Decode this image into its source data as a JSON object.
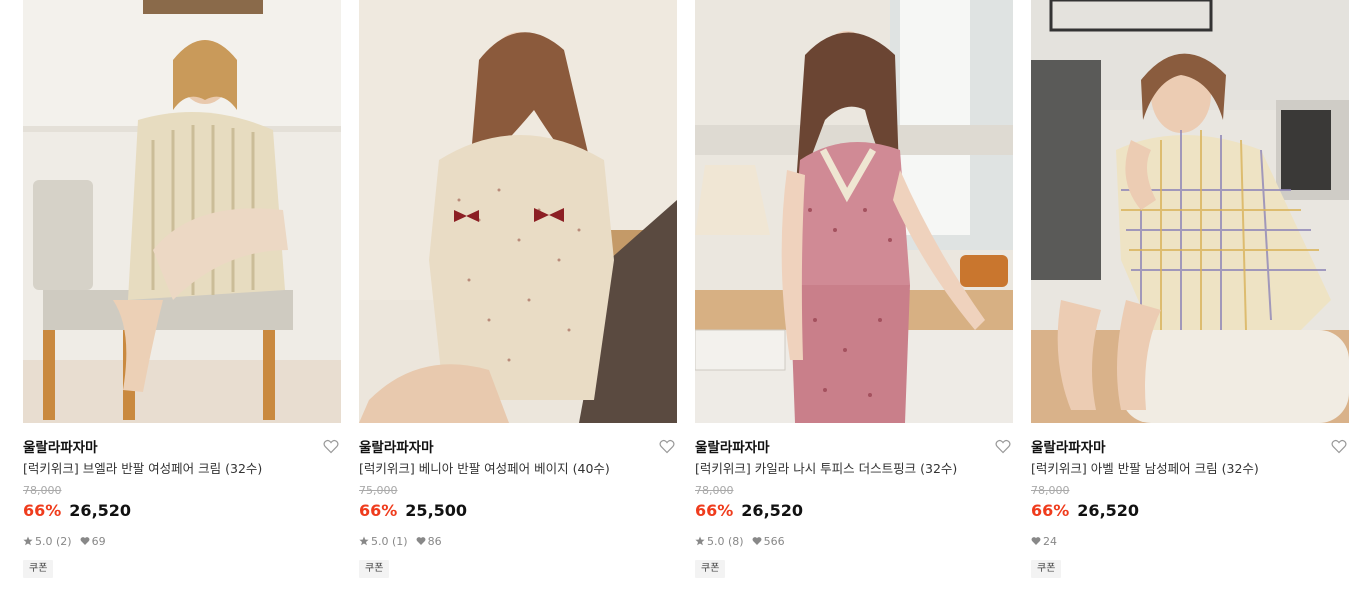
{
  "products": [
    {
      "brand": "울랄라파자마",
      "title": "[럭키위크] 브엘라 반팔 여성페어 크림 (32수)",
      "original_price": "78,000",
      "discount": "66%",
      "price": "26,520",
      "rating": "5.0",
      "review_count": "(2)",
      "likes": "69",
      "coupon": "쿠폰"
    },
    {
      "brand": "울랄라파자마",
      "title": "[럭키위크] 베니아 반팔 여성페어 베이지 (40수)",
      "original_price": "75,000",
      "discount": "66%",
      "price": "25,500",
      "rating": "5.0",
      "review_count": "(1)",
      "likes": "86",
      "coupon": "쿠폰"
    },
    {
      "brand": "울랄라파자마",
      "title": "[럭키위크] 카일라 나시 투피스 더스트핑크 (32수)",
      "original_price": "78,000",
      "discount": "66%",
      "price": "26,520",
      "rating": "5.0",
      "review_count": "(8)",
      "likes": "566",
      "coupon": "쿠폰"
    },
    {
      "brand": "울랄라파자마",
      "title": "[럭키위크] 아벨 반팔 남성페어 크림 (32수)",
      "original_price": "78,000",
      "discount": "66%",
      "price": "26,520",
      "likes": "24",
      "coupon": "쿠폰"
    }
  ],
  "colors": {
    "discount": "#ef3c1d",
    "text": "#111111",
    "muted": "#888888",
    "strike": "#aaaaaa",
    "coupon_bg": "#f3f3f3"
  },
  "icons": {
    "wishlist": "heart-outline-icon",
    "rating": "star-icon",
    "likes": "heart-filled-icon"
  }
}
